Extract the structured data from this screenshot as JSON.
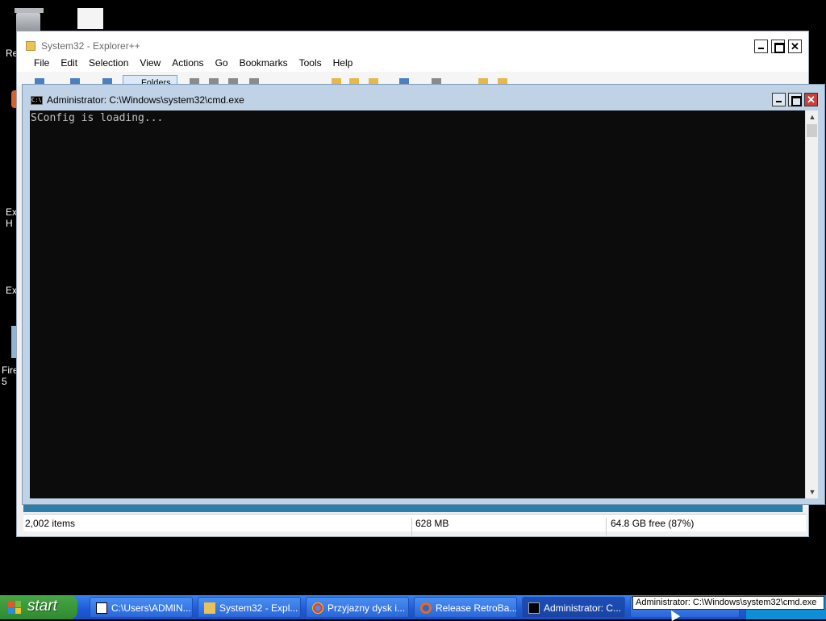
{
  "desktop": {
    "icons": [
      {
        "label": "Re"
      },
      {
        "label": "Ex H"
      },
      {
        "label": "Ex"
      },
      {
        "label": "Fire 5"
      }
    ]
  },
  "explorer": {
    "title": "System32 - Explorer++",
    "menu": [
      "File",
      "Edit",
      "Selection",
      "View",
      "Actions",
      "Go",
      "Bookmarks",
      "Tools",
      "Help"
    ],
    "folders_button": "Folders",
    "status": {
      "items": "2,002 items",
      "size": "628 MB",
      "free": "64.8 GB free (87%)"
    },
    "close_glyph": "✕"
  },
  "cmd": {
    "title": "Administrator: C:\\Windows\\system32\\cmd.exe",
    "output": "SConfig is loading...",
    "icon_text": "C:\\",
    "close_glyph": "✕"
  },
  "taskbar": {
    "start_label": "start",
    "tasks": [
      {
        "label": "C:\\Users\\ADMIN...",
        "icon": "7zip-icon"
      },
      {
        "label": "System32 - Expl...",
        "icon": "folder-icon"
      },
      {
        "label": "Przyjazny dysk i...",
        "icon": "chrome-icon"
      },
      {
        "label": "Release RetroBa...",
        "icon": "firefox-icon"
      },
      {
        "label": "Administrator: C...",
        "icon": "cmd-icon"
      }
    ],
    "tooltip": "Administrator: C:\\Windows\\system32\\cmd.exe"
  },
  "colors": {
    "taskbar_blue": "#245edb",
    "start_green": "#3c9a3c",
    "cmd_frame": "#bfd2e6",
    "console_bg": "#0c0c0c"
  }
}
